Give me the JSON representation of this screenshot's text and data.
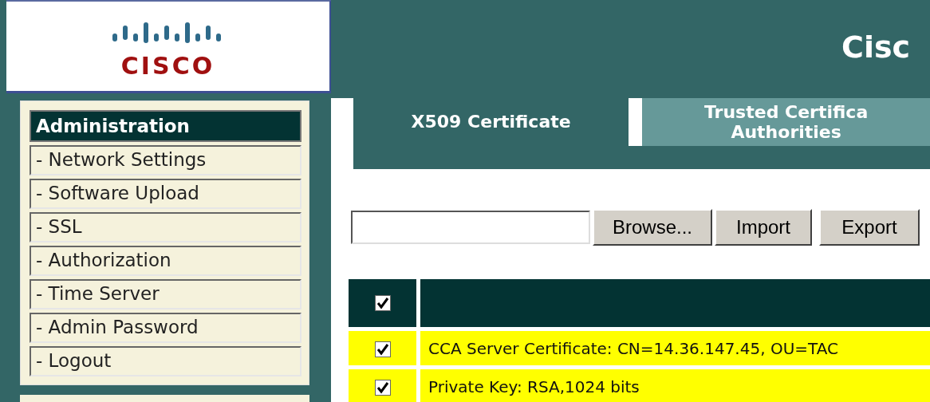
{
  "logo": {
    "text": "CISCO"
  },
  "header": {
    "title": "Cisc"
  },
  "sidebar": {
    "title": "Administration",
    "items": [
      {
        "label": "- Network Settings"
      },
      {
        "label": "- Software Upload"
      },
      {
        "label": "- SSL"
      },
      {
        "label": "- Authorization"
      },
      {
        "label": "- Time Server"
      },
      {
        "label": "- Admin Password"
      },
      {
        "label": "- Logout"
      }
    ]
  },
  "tabs": [
    {
      "lines": [
        "X509 Certificate"
      ],
      "selected": true
    },
    {
      "lines": [
        "Trusted Certifica",
        "Authorities"
      ],
      "selected": false
    }
  ],
  "buttons": [
    "Browse...",
    "Import",
    "Export"
  ],
  "table": {
    "header_checked": true,
    "rows": [
      {
        "checked": true,
        "text": "CCA Server Certificate: CN=14.36.147.45, OU=TAC"
      },
      {
        "checked": true,
        "text": "Private Key: RSA,1024 bits"
      }
    ]
  }
}
